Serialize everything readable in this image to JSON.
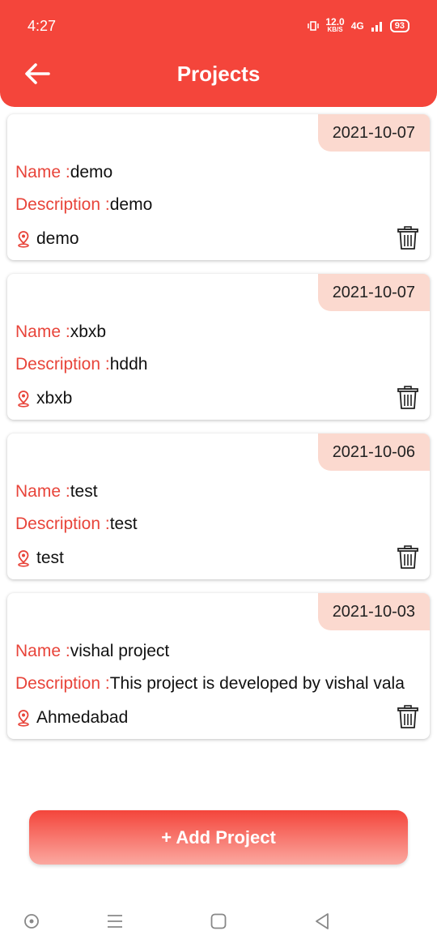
{
  "status_bar": {
    "time": "4:27",
    "speed_value": "12.0",
    "speed_unit": "KB/S",
    "network": "4G",
    "battery": "93"
  },
  "header": {
    "title": "Projects"
  },
  "labels": {
    "name": "Name :",
    "description": "Description :"
  },
  "projects": [
    {
      "date": "2021-10-07",
      "name": "demo",
      "description": "demo",
      "location": "demo"
    },
    {
      "date": "2021-10-07",
      "name": "xbxb",
      "description": "hddh",
      "location": "xbxb"
    },
    {
      "date": "2021-10-06",
      "name": "test",
      "description": "test",
      "location": "test"
    },
    {
      "date": "2021-10-03",
      "name": "vishal project",
      "description": "This project is developed by vishal vala",
      "location": "Ahmedabad"
    }
  ],
  "add_button": {
    "label": "+ Add Project"
  },
  "colors": {
    "accent": "#f4453b",
    "badge": "#fbd9cf",
    "label": "#e8443a"
  },
  "icons": [
    "back-arrow-icon",
    "location-pin-icon",
    "trash-icon",
    "home-circle-icon",
    "menu-icon",
    "square-icon",
    "back-triangle-icon"
  ]
}
